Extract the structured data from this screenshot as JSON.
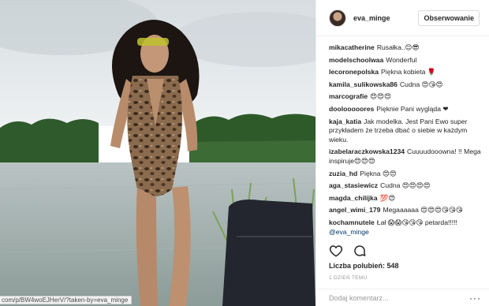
{
  "post": {
    "status_url": "com/p/BW4woEJHerV/?taken-by=eva_minge"
  },
  "header": {
    "username": "eva_minge",
    "follow_label": "Obserwowanie"
  },
  "comments": [
    {
      "user": "mikacatherine",
      "text": "Rusałka..😊😎"
    },
    {
      "user": "modelschoolwaa",
      "text": "Wonderful"
    },
    {
      "user": "lecoronepolska",
      "text": "Piękna kobieta 🌹"
    },
    {
      "user": "kamila_sulikowska86",
      "text": "Cudna 😍😘😍"
    },
    {
      "user": "marcografie",
      "text": "😍😍😍"
    },
    {
      "user": "doolooooores",
      "text": "Pięknie Pani wygląda ❤"
    },
    {
      "user": "kaja_katia",
      "text": "Jak modelka. Jest Pani Ewo super przykładem że trzeba dbać o siebie w każdym wieku."
    },
    {
      "user": "izabelaraczkowska1234",
      "text": "Cuuuudooowna! !! Mega inspiruje😍😍😍"
    },
    {
      "user": "zuzia_hd",
      "text": "Piękna 😍😍"
    },
    {
      "user": "aga_stasiewicz",
      "text": "Cudna 😍😍😍😍"
    },
    {
      "user": "magda_chilijka",
      "text": "💯😍"
    },
    {
      "user": "angel_wimi_179",
      "text": "Megaaaaaa 😍😍😍😘😘😘"
    },
    {
      "user": "kochamnutele",
      "text": "Łał 😱😱😘😘😘 petarda!!!!!",
      "mention": "@eva_minge"
    }
  ],
  "icons": {
    "like": "heart-icon",
    "comment": "comment-bubble-icon",
    "more": "more-dots-icon"
  },
  "likes_text": "Liczba polubień: 548",
  "time_text": "1 DZIEŃ TEMU",
  "add_comment_placeholder": "Dodaj komentarz...",
  "more_label": "···"
}
